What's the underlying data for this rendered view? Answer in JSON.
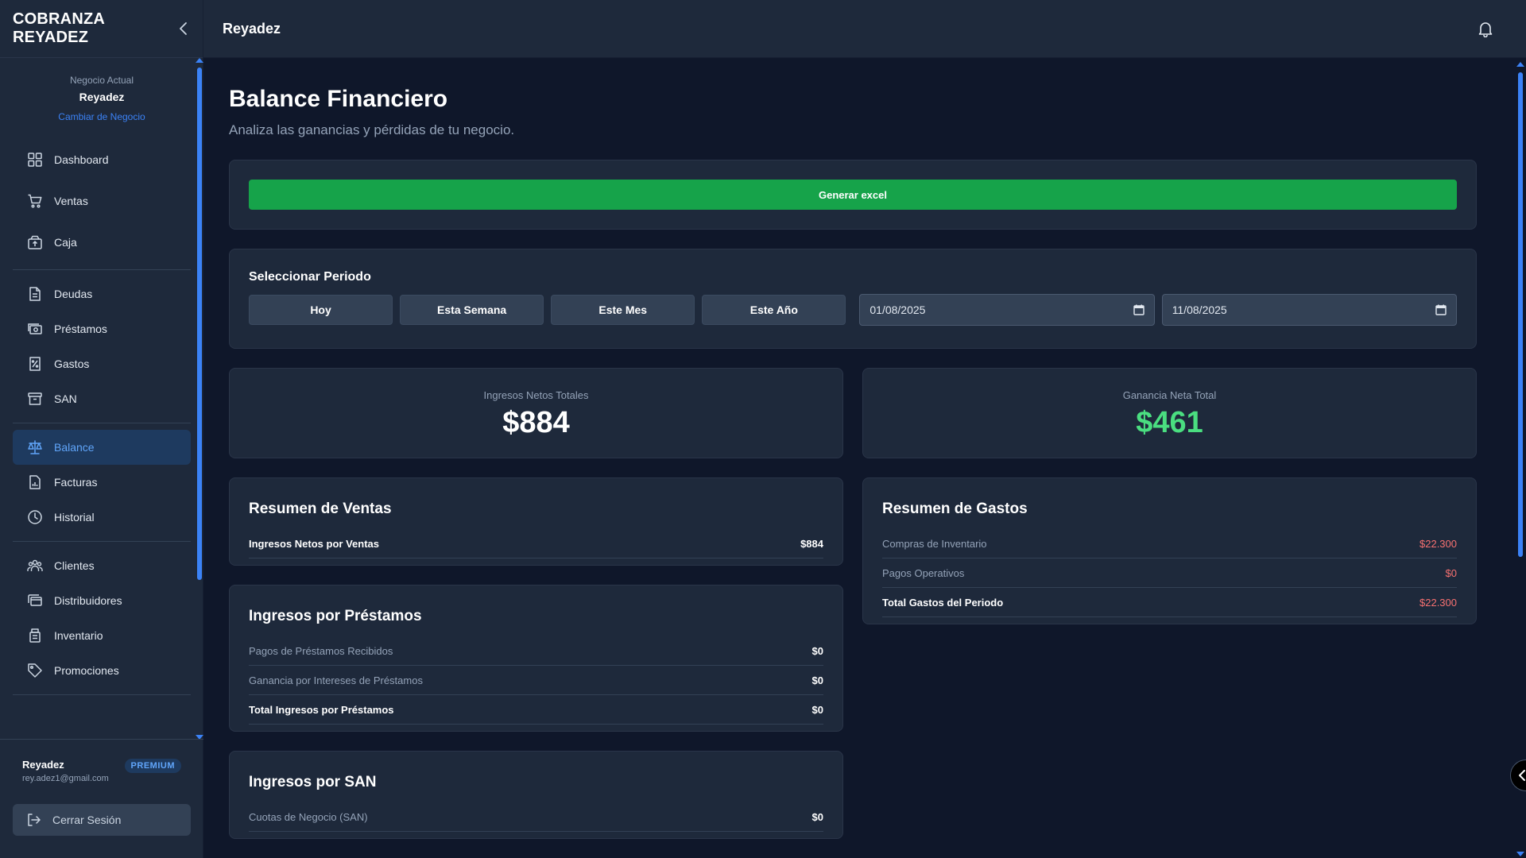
{
  "sidebar": {
    "brand": "COBRANZA REYADEZ",
    "business": {
      "label": "Negocio Actual",
      "name": "Reyadez",
      "change_link": "Cambiar de Negocio"
    },
    "groups": [
      [
        {
          "label": "Dashboard",
          "icon": "grid-icon"
        },
        {
          "label": "Ventas",
          "icon": "cart-icon"
        },
        {
          "label": "Caja",
          "icon": "cash-box-icon"
        }
      ],
      [
        {
          "label": "Deudas",
          "icon": "document-icon"
        },
        {
          "label": "Préstamos",
          "icon": "money-icon"
        },
        {
          "label": "Gastos",
          "icon": "receipt-icon"
        },
        {
          "label": "SAN",
          "icon": "archive-icon"
        }
      ],
      [
        {
          "label": "Balance",
          "icon": "scale-icon",
          "active": true
        },
        {
          "label": "Facturas",
          "icon": "invoice-chart-icon"
        },
        {
          "label": "Historial",
          "icon": "clock-icon"
        }
      ],
      [
        {
          "label": "Clientes",
          "icon": "users-icon"
        },
        {
          "label": "Distribuidores",
          "icon": "cards-icon"
        },
        {
          "label": "Inventario",
          "icon": "inventory-icon"
        },
        {
          "label": "Promociones",
          "icon": "tag-icon"
        }
      ]
    ],
    "user": {
      "name": "Reyadez",
      "email": "rey.adez1@gmail.com",
      "plan": "PREMIUM"
    },
    "logout_label": "Cerrar Sesión"
  },
  "topbar": {
    "title": "Reyadez"
  },
  "page": {
    "title": "Balance Financiero",
    "subtitle": "Analiza las ganancias y pérdidas de tu negocio.",
    "export_button": "Generar excel"
  },
  "period": {
    "title": "Seleccionar Periodo",
    "buttons": [
      "Hoy",
      "Esta Semana",
      "Este Mes",
      "Este Año"
    ],
    "date_from": "01/08/2025",
    "date_to": "11/08/2025"
  },
  "stats": {
    "income_label": "Ingresos Netos Totales",
    "income_value": "$884",
    "profit_label": "Ganancia Neta Total",
    "profit_value": "$461"
  },
  "sales_summary": {
    "title": "Resumen de Ventas",
    "rows": [
      {
        "label": "Ingresos Netos por Ventas",
        "value": "$884"
      }
    ]
  },
  "loans_income": {
    "title": "Ingresos por Préstamos",
    "rows": [
      {
        "label": "Pagos de Préstamos Recibidos",
        "value": "$0"
      },
      {
        "label": "Ganancia por Intereses de Préstamos",
        "value": "$0"
      },
      {
        "label": "Total Ingresos por Préstamos",
        "value": "$0"
      }
    ]
  },
  "san_income": {
    "title": "Ingresos por SAN",
    "rows": [
      {
        "label": "Cuotas de Negocio (SAN)",
        "value": "$0"
      }
    ]
  },
  "expenses_summary": {
    "title": "Resumen de Gastos",
    "rows": [
      {
        "label": "Compras de Inventario",
        "value": "$22.300"
      },
      {
        "label": "Pagos Operativos",
        "value": "$0"
      },
      {
        "label": "Total Gastos del Periodo",
        "value": "$22.300"
      }
    ]
  },
  "colors": {
    "background": "#0f172a",
    "surface": "#1e293b",
    "accent": "#3b82f6",
    "success": "#16a34a",
    "profit": "#4ade80",
    "expense": "#f87171"
  }
}
